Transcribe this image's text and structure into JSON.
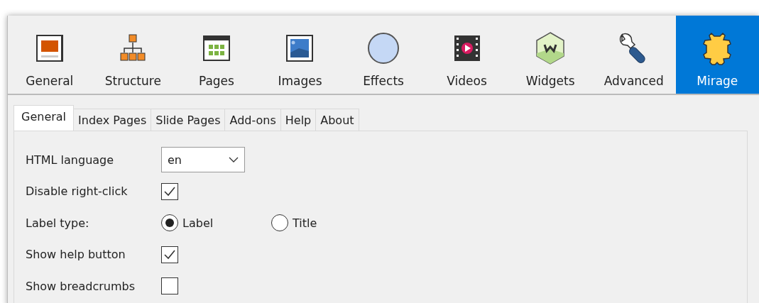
{
  "toolbar": [
    {
      "label": "General",
      "selected": false
    },
    {
      "label": "Structure",
      "selected": false
    },
    {
      "label": "Pages",
      "selected": false
    },
    {
      "label": "Images",
      "selected": false
    },
    {
      "label": "Effects",
      "selected": false
    },
    {
      "label": "Videos",
      "selected": false
    },
    {
      "label": "Widgets",
      "selected": false
    },
    {
      "label": "Advanced",
      "selected": false
    },
    {
      "label": "Mirage",
      "selected": true
    }
  ],
  "tabs": [
    {
      "label": "General",
      "selected": true
    },
    {
      "label": "Index Pages",
      "selected": false
    },
    {
      "label": "Slide Pages",
      "selected": false
    },
    {
      "label": "Add-ons",
      "selected": false
    },
    {
      "label": "Help",
      "selected": false
    },
    {
      "label": "About",
      "selected": false
    }
  ],
  "settings": [
    {
      "kind": "dropdown",
      "label": "HTML language",
      "value": "en"
    },
    {
      "kind": "checkbox",
      "label": "Disable right-click",
      "checked": true
    },
    {
      "kind": "radio",
      "label": "Label type:",
      "options": [
        {
          "label": "Label",
          "selected": true
        },
        {
          "label": "Title",
          "selected": false
        }
      ]
    },
    {
      "kind": "checkbox",
      "label": "Show help button",
      "checked": true
    },
    {
      "kind": "checkbox",
      "label": "Show breadcrumbs",
      "checked": false
    }
  ]
}
